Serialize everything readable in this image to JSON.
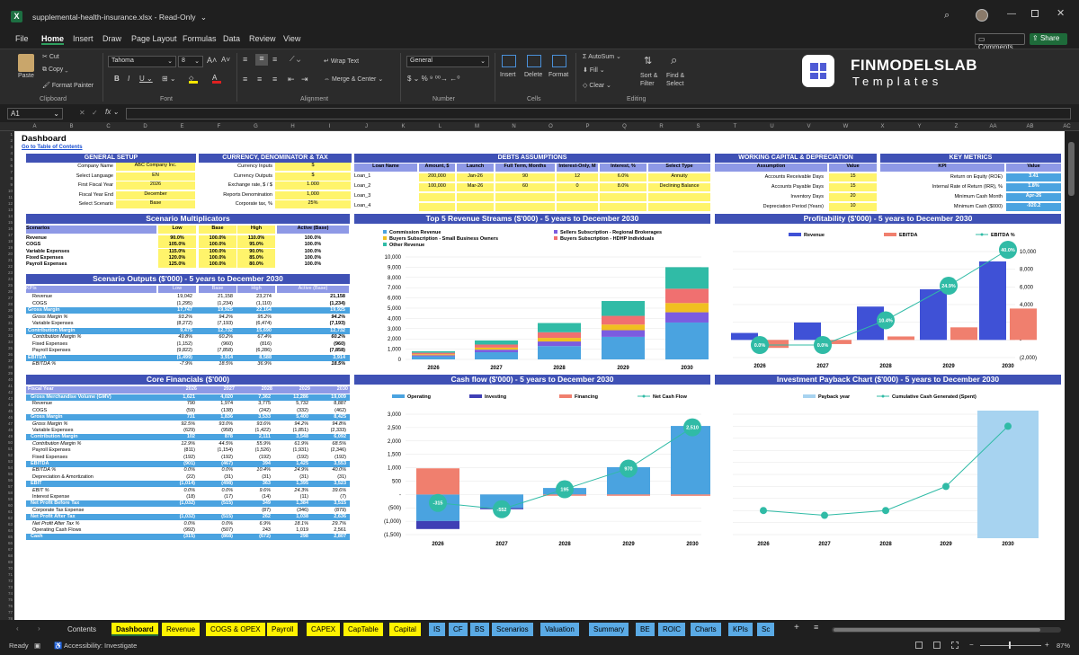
{
  "window": {
    "filename": "supplemental-health-insurance.xlsx",
    "mode": "Read-Only"
  },
  "menu": [
    "File",
    "Home",
    "Insert",
    "Draw",
    "Page Layout",
    "Formulas",
    "Data",
    "Review",
    "View"
  ],
  "menu_active": "Home",
  "comments_label": "Comments",
  "share_label": "Share",
  "ribbon": {
    "paste": "Paste",
    "cut": "Cut",
    "copy": "Copy",
    "format_painter": "Format Painter",
    "clipboard": "Clipboard",
    "font_name": "Tahoma",
    "font_size": "8",
    "font": "Font",
    "wrap_text": "Wrap Text",
    "merge_center": "Merge & Center",
    "alignment": "Alignment",
    "number_format": "General",
    "number": "Number",
    "insert": "Insert",
    "delete": "Delete",
    "format": "Format",
    "cells": "Cells",
    "autosum": "AutoSum",
    "fill": "Fill",
    "clear": "Clear",
    "sort_filter": "Sort & Filter",
    "find_select": "Find & Select",
    "editing": "Editing"
  },
  "logo": {
    "line1": "FINMODELSLAB",
    "line2": "Templates"
  },
  "name_box": "A1",
  "columns": [
    "A",
    "B",
    "C",
    "D",
    "E",
    "F",
    "G",
    "H",
    "I",
    "J",
    "K",
    "L",
    "M",
    "N",
    "O",
    "P",
    "Q",
    "R",
    "S",
    "T",
    "U",
    "V",
    "W",
    "X",
    "Y",
    "Z",
    "AA",
    "AB",
    "AC"
  ],
  "sheet": {
    "title": "Dashboard",
    "toc_link": "Go to Table of Contents",
    "general_setup": {
      "header": "GENERAL SETUP",
      "rows": [
        [
          "Company Name",
          "ABC Company Inc."
        ],
        [
          "Select Language",
          "EN"
        ],
        [
          "First Fiscal Year",
          "2026"
        ],
        [
          "Fiscal Year End",
          "December"
        ],
        [
          "Select Scenario",
          "Base"
        ]
      ]
    },
    "currency": {
      "header": "CURRENCY, DENOMINATOR & TAX",
      "rows": [
        [
          "Currency Inputs",
          "$"
        ],
        [
          "Currency Outputs",
          "$"
        ],
        [
          "Exchange rate, $ / $",
          "1.000"
        ],
        [
          "Reports Denomination",
          "1,000"
        ],
        [
          "Corporate tax, %",
          "25%"
        ]
      ]
    },
    "debts": {
      "header": "DEBTS ASSUMPTIONS",
      "columns": [
        "Loan Name",
        "Amount, $",
        "Launch",
        "Full Term, Months",
        "Interest-Only, M",
        "Interest, %",
        "Select Type"
      ],
      "rows": [
        [
          "Loan_1",
          "200,000",
          "Jan-26",
          "90",
          "12",
          "6.0%",
          "Annuity"
        ],
        [
          "Loan_2",
          "100,000",
          "Mar-26",
          "60",
          "0",
          "8.0%",
          "Declining Balance"
        ],
        [
          "Loan_3",
          "",
          "",
          "",
          "",
          "",
          ""
        ],
        [
          "Loan_4",
          "",
          "",
          "",
          "",
          "",
          ""
        ]
      ]
    },
    "working_capital": {
      "header": "WORKING CAPITAL & DEPRECIATION",
      "columns": [
        "Assumption",
        "Value"
      ],
      "rows": [
        [
          "Accounts Receivable Days",
          "15"
        ],
        [
          "Accounts Payable Days",
          "15"
        ],
        [
          "Inventory Days",
          "20"
        ],
        [
          "Depreciation Period (Years)",
          "10"
        ]
      ]
    },
    "key_metrics": {
      "header": "KEY METRICS",
      "columns": [
        "KPI",
        "Value"
      ],
      "rows": [
        [
          "Return on Equity (ROE)",
          "3.41"
        ],
        [
          "Internal Rate of Return (IRR), %",
          "1.8%"
        ],
        [
          "Minimum Cash Month",
          "Apr-26"
        ],
        [
          "Minimum Cash ($000)",
          "-920.2"
        ]
      ]
    },
    "scenario_mult": {
      "header": "Scenario Multiplicators",
      "columns": [
        "Scenarios",
        "Low",
        "Base",
        "High",
        "Active (Base)"
      ],
      "rows": [
        [
          "Revenue",
          "90.0%",
          "100.0%",
          "110.0%",
          "100.0%"
        ],
        [
          "COGS",
          "105.0%",
          "100.0%",
          "95.0%",
          "100.0%"
        ],
        [
          "Variable Expenses",
          "115.0%",
          "100.0%",
          "90.0%",
          "100.0%"
        ],
        [
          "Fixed Expenses",
          "120.0%",
          "100.0%",
          "85.0%",
          "100.0%"
        ],
        [
          "Payroll Expenses",
          "125.0%",
          "100.0%",
          "80.0%",
          "100.0%"
        ]
      ]
    },
    "scenario_out": {
      "header": "Scenario Outputs ($'000) - 5 years to December 2030",
      "columns": [
        "KPIs",
        "Low",
        "Base",
        "High",
        "Active (Base)"
      ],
      "rows": [
        [
          "Revenue",
          "19,042",
          "21,158",
          "23,274",
          "21,158",
          "n"
        ],
        [
          "COGS",
          "(1,295)",
          "(1,234)",
          "(1,110)",
          "(1,234)",
          "n"
        ],
        [
          "Gross Margin",
          "17,747",
          "19,925",
          "22,164",
          "19,925",
          "b"
        ],
        [
          "Gross Margin %",
          "93.2%",
          "94.2%",
          "95.2%",
          "94.2%",
          "i"
        ],
        [
          "Variable Expenses",
          "(8,272)",
          "(7,193)",
          "(6,474)",
          "(7,193)",
          "n"
        ],
        [
          "Contribution Margin",
          "9,475",
          "12,732",
          "15,690",
          "12,732",
          "b"
        ],
        [
          "Contribution Margin %",
          "49.8%",
          "60.2%",
          "67.4%",
          "60.2%",
          "i"
        ],
        [
          "Fixed Expenses",
          "(1,152)",
          "(960)",
          "(816)",
          "(960)",
          "n"
        ],
        [
          "Payroll Expenses",
          "(9,822)",
          "(7,858)",
          "(6,286)",
          "(7,858)",
          "n"
        ],
        [
          "EBITDA",
          "(1,499)",
          "3,914",
          "8,588",
          "3,914",
          "b"
        ],
        [
          "EBITDA %",
          "-7.9%",
          "18.5%",
          "36.9%",
          "18.5%",
          "i"
        ]
      ]
    },
    "core": {
      "header": "Core Financials ($'000)",
      "columns": [
        "Fiscal Year",
        "2026",
        "2027",
        "2028",
        "2029",
        "2030"
      ],
      "rows": [
        [
          "Gross Merchandise Volume (GMV)",
          "1,621",
          "4,020",
          "7,362",
          "12,286",
          "19,009",
          "b"
        ],
        [
          "Revenue",
          "790",
          "1,974",
          "3,775",
          "5,732",
          "8,887",
          "n"
        ],
        [
          "COGS",
          "(59)",
          "(138)",
          "(242)",
          "(332)",
          "(462)",
          "n"
        ],
        [
          "Gross Margin",
          "731",
          "1,836",
          "3,533",
          "5,400",
          "8,425",
          "b"
        ],
        [
          "Gross Margin %",
          "92.5%",
          "93.0%",
          "93.6%",
          "94.2%",
          "94.8%",
          "i"
        ],
        [
          "Variable Expenses",
          "(629)",
          "(958)",
          "(1,422)",
          "(1,851)",
          "(2,333)",
          "n"
        ],
        [
          "Contribution Margin",
          "102",
          "878",
          "2,111",
          "3,548",
          "6,092",
          "b"
        ],
        [
          "Contribution Margin %",
          "12.9%",
          "44.5%",
          "55.9%",
          "61.9%",
          "68.5%",
          "i"
        ],
        [
          "Payroll Expenses",
          "(811)",
          "(1,154)",
          "(1,526)",
          "(1,931)",
          "(2,346)",
          "n"
        ],
        [
          "Fixed Expenses",
          "(192)",
          "(192)",
          "(192)",
          "(192)",
          "(192)",
          "n"
        ],
        [
          "EBITDA",
          "(901)",
          "(467)",
          "394",
          "1,425",
          "3,553",
          "b"
        ],
        [
          "EBITDA %",
          "0.0%",
          "0.0%",
          "10.4%",
          "24.9%",
          "40.0%",
          "i"
        ],
        [
          "Depreciation & Amortization",
          "(22)",
          "(31)",
          "(31)",
          "(31)",
          "(31)",
          "n"
        ],
        [
          "EBIT",
          "(1,014)",
          "(498)",
          "363",
          "1,395",
          "3,523",
          "b"
        ],
        [
          "EBIT %",
          "0.0%",
          "0.0%",
          "9.6%",
          "24.3%",
          "39.6%",
          "i"
        ],
        [
          "Interest Expense",
          "(18)",
          "(17)",
          "(14)",
          "(11)",
          "(7)",
          "n"
        ],
        [
          "Net Profit Before Tax",
          "(1,032)",
          "(515)",
          "349",
          "1,384",
          "3,515",
          "b"
        ],
        [
          "Corporate Tax Expense",
          "",
          "",
          "(87)",
          "(346)",
          "(879)",
          "n"
        ],
        [
          "Net Profit After Tax",
          "(1,032)",
          "(515)",
          "262",
          "1,038",
          "2,636",
          "b"
        ],
        [
          "Net Profit After Tax %",
          "0.0%",
          "0.0%",
          "6.9%",
          "18.1%",
          "29.7%",
          "i"
        ],
        [
          "Operating Cash Flows",
          "(992)",
          "(507)",
          "243",
          "1,019",
          "2,561",
          "n"
        ],
        [
          "Cash",
          "(315)",
          "(868)",
          "(672)",
          "298",
          "2,807",
          "b"
        ]
      ]
    }
  },
  "chart_data": [
    {
      "type": "bar",
      "title": "Top 5 Revenue Streams ($'000) - 5 years to December 2030",
      "categories": [
        "2026",
        "2027",
        "2028",
        "2029",
        "2030"
      ],
      "ylim": [
        0,
        10000
      ],
      "yticks": [
        "0",
        "1,000",
        "2,000",
        "3,000",
        "4,000",
        "5,000",
        "6,000",
        "7,000",
        "8,000",
        "9,000",
        "10,000"
      ],
      "series": [
        {
          "name": "Commission Revenue",
          "color": "#4aa3e0",
          "values": [
            300,
            700,
            1300,
            2200,
            3600
          ]
        },
        {
          "name": "Sellers Subscription - Regional Brokerages",
          "color": "#7b5ce0",
          "values": [
            100,
            250,
            450,
            650,
            1000
          ]
        },
        {
          "name": "Buyers Subscription - Small Business Owners",
          "color": "#f0c020",
          "values": [
            100,
            200,
            350,
            550,
            900
          ]
        },
        {
          "name": "Buyers Subscription - HDHP Individuals",
          "color": "#f07070",
          "values": [
            150,
            300,
            550,
            850,
            1400
          ]
        },
        {
          "name": "Other Revenue",
          "color": "#30bba6",
          "values": [
            150,
            400,
            900,
            1450,
            2100
          ]
        }
      ]
    },
    {
      "type": "bar",
      "title": "Profitability ($'000) - 5 years to December 2030",
      "categories": [
        "2026",
        "2027",
        "2028",
        "2029",
        "2030"
      ],
      "ylim": [
        -2000,
        10000
      ],
      "yticks": [
        "(2,000)",
        "-",
        "2,000",
        "4,000",
        "6,000",
        "8,000",
        "10,000"
      ],
      "series": [
        {
          "name": "Revenue",
          "color": "#3f51d6",
          "values": [
            790,
            1974,
            3775,
            5732,
            8887
          ]
        },
        {
          "name": "EBITDA",
          "color": "#f07f6e",
          "values": [
            -901,
            -467,
            394,
            1425,
            3553
          ]
        },
        {
          "name": "EBITDA %",
          "color": "#30bba6",
          "values": [
            0.0,
            0.0,
            10.4,
            24.9,
            40.0
          ],
          "labels": [
            "0.0%",
            "0.0%",
            "10.4%",
            "24.9%",
            "40.0%"
          ]
        }
      ]
    },
    {
      "type": "bar",
      "title": "Cash flow ($'000) - 5 years to December 2030",
      "categories": [
        "2026",
        "2027",
        "2028",
        "2029",
        "2030"
      ],
      "ylim": [
        -1500,
        3000
      ],
      "yticks": [
        "(1,500)",
        "(1,000)",
        "(500)",
        "-",
        "500",
        "1,000",
        "1,500",
        "2,000",
        "2,500",
        "3,000"
      ],
      "series": [
        {
          "name": "Operating",
          "color": "#4aa3e0",
          "values": [
            -992,
            -507,
            243,
            1019,
            2561
          ]
        },
        {
          "name": "Investing",
          "color": "#3f3fb5",
          "values": [
            -300,
            -45,
            0,
            0,
            0
          ]
        },
        {
          "name": "Financing",
          "color": "#f07f6e",
          "values": [
            977,
            0,
            -48,
            -49,
            -51
          ]
        },
        {
          "name": "Net Cash Flow",
          "color": "#30bba6",
          "values": [
            -315,
            -552,
            195,
            970,
            2510
          ],
          "labels": [
            "-315",
            "-552",
            "195",
            "970",
            "2,510"
          ]
        }
      ]
    },
    {
      "type": "line",
      "title": "Investment Payback Chart ($'000) - 5 years to December 2030",
      "categories": [
        "2026",
        "2027",
        "2028",
        "2029",
        "2030"
      ],
      "ylim": [
        -2000,
        3000
      ],
      "yticks": [
        "(2,000)",
        "(1,500)",
        "(1,000)",
        "(500)",
        "-",
        "500",
        "1,000",
        "1,500",
        "2,000",
        "2,500",
        "3,000"
      ],
      "series": [
        {
          "name": "Payback year",
          "color": "#a7d3f0",
          "values": [
            0,
            0,
            0,
            0,
            1
          ]
        },
        {
          "name": "Cumulative Cash Generated (Spent)",
          "color": "#30bba6",
          "values": [
            -1000,
            -1200,
            -1000,
            0,
            2500
          ]
        }
      ]
    }
  ],
  "tabs": [
    {
      "label": "Contents",
      "style": "plain"
    },
    {
      "label": "Dashboard",
      "style": "active"
    },
    {
      "label": "Revenue",
      "style": "y"
    },
    {
      "label": "COGS & OPEX",
      "style": "y"
    },
    {
      "label": "Payroll",
      "style": "y"
    },
    {
      "label": "CAPEX",
      "style": "y"
    },
    {
      "label": "CapTable",
      "style": "y"
    },
    {
      "label": "Capital",
      "style": "y"
    },
    {
      "label": "IS",
      "style": "b"
    },
    {
      "label": "CF",
      "style": "b"
    },
    {
      "label": "BS",
      "style": "b"
    },
    {
      "label": "Scenarios",
      "style": "b"
    },
    {
      "label": "Valuation",
      "style": "b"
    },
    {
      "label": "Summary",
      "style": "b"
    },
    {
      "label": "BE",
      "style": "b"
    },
    {
      "label": "ROIC",
      "style": "b"
    },
    {
      "label": "Charts",
      "style": "b"
    },
    {
      "label": "KPIs",
      "style": "b"
    },
    {
      "label": "Sc",
      "style": "b"
    }
  ],
  "status": {
    "ready": "Ready",
    "accessibility": "Accessibility: Investigate",
    "zoom": "87%"
  }
}
